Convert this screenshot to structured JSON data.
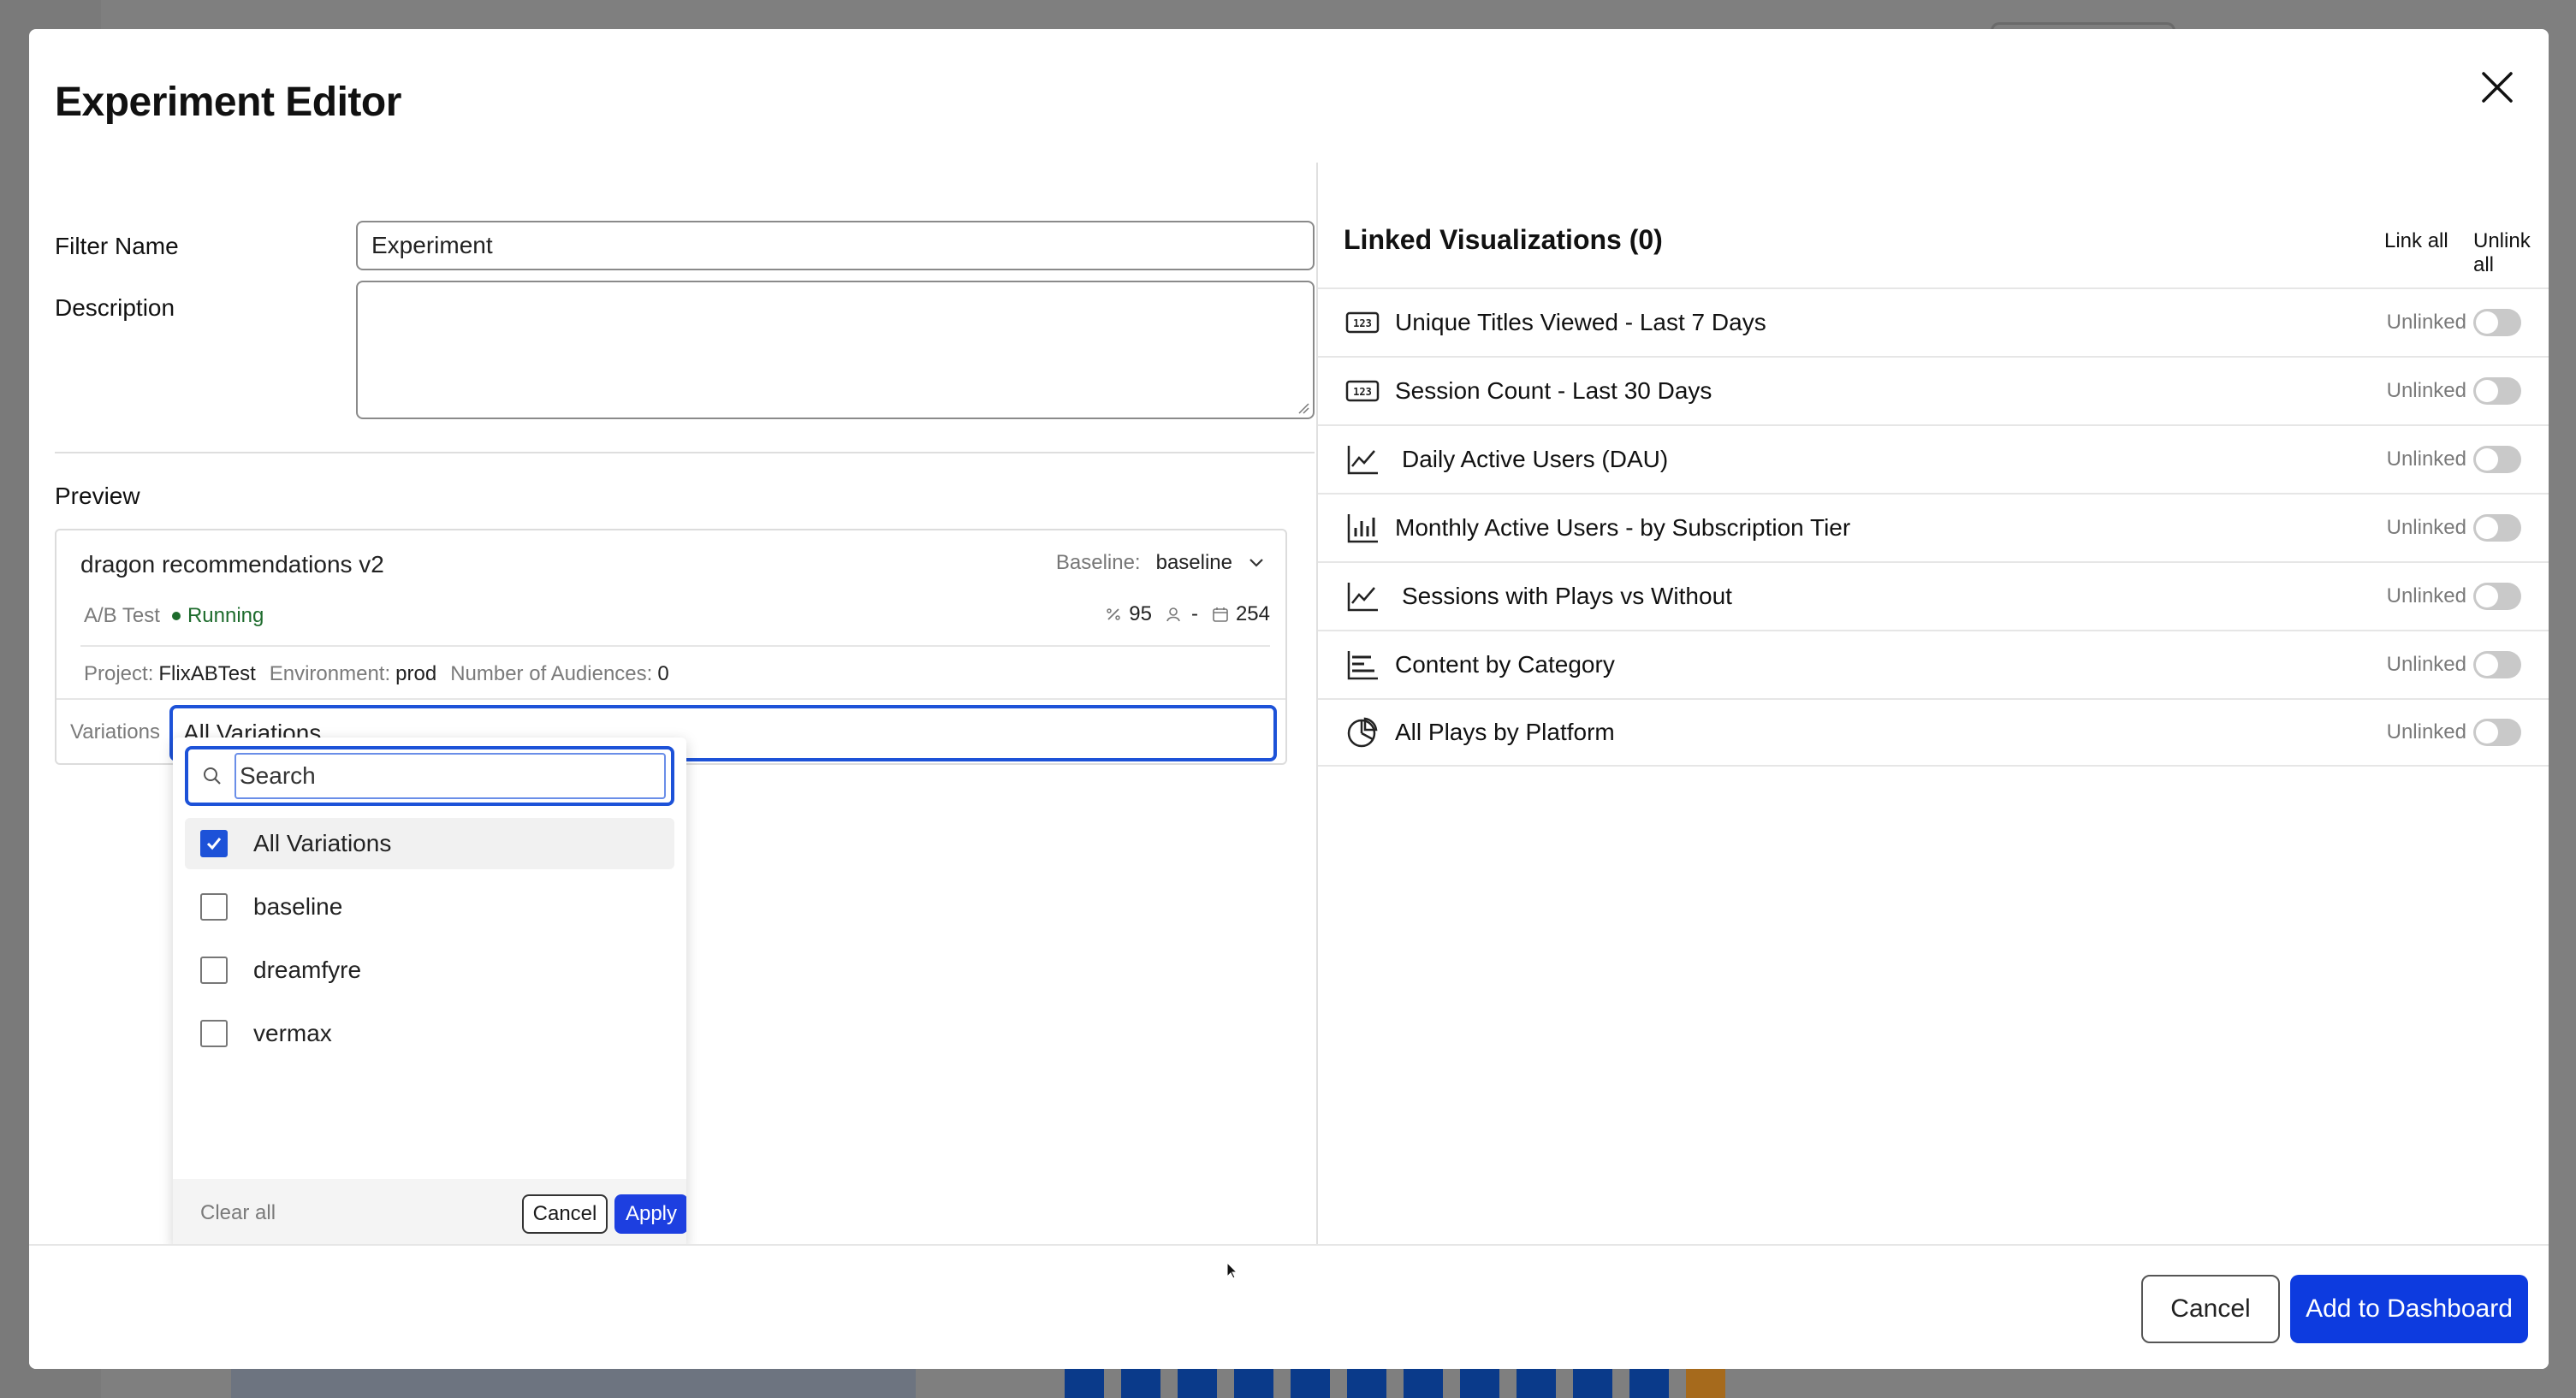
{
  "modal": {
    "title": "Experiment Editor"
  },
  "form": {
    "filter_name_label": "Filter Name",
    "filter_name_value": "Experiment",
    "description_label": "Description",
    "description_value": ""
  },
  "preview": {
    "section_title": "Preview",
    "experiment_name": "dragon recommendations v2",
    "baseline_label": "Baseline:",
    "baseline_value": "baseline",
    "type": "A/B Test",
    "status": "Running",
    "stat_traffic": "95",
    "stat_audience": "-",
    "stat_days": "254",
    "project_label": "Project:",
    "project_value": "FlixABTest",
    "environment_label": "Environment:",
    "environment_value": "prod",
    "audiences_label": "Number of Audiences:",
    "audiences_value": "0",
    "variations_label": "Variations",
    "variations_value": "All Variations"
  },
  "dropdown": {
    "search_placeholder": "Search",
    "items": [
      {
        "label": "All Variations",
        "checked": true
      },
      {
        "label": "baseline",
        "checked": false
      },
      {
        "label": "dreamfyre",
        "checked": false
      },
      {
        "label": "vermax",
        "checked": false
      }
    ],
    "clear_label": "Clear all",
    "cancel_label": "Cancel",
    "apply_label": "Apply"
  },
  "linked": {
    "title": "Linked Visualizations (0)",
    "link_all": "Link all",
    "unlink_all": "Unlink all",
    "items": [
      {
        "name": "Unique Titles Viewed - Last 7 Days",
        "icon": "number-icon",
        "status": "Unlinked"
      },
      {
        "name": "Session Count - Last 30 Days",
        "icon": "number-icon",
        "status": "Unlinked"
      },
      {
        "name": "Daily Active Users (DAU)",
        "icon": "line-chart-icon",
        "status": "Unlinked"
      },
      {
        "name": "Monthly Active Users - by Subscription Tier",
        "icon": "bar-chart-icon",
        "status": "Unlinked"
      },
      {
        "name": "Sessions with Plays vs Without",
        "icon": "line-chart-icon",
        "status": "Unlinked"
      },
      {
        "name": "Content by Category",
        "icon": "horizontal-bar-chart-icon",
        "status": "Unlinked"
      },
      {
        "name": "All Plays by Platform",
        "icon": "pie-chart-icon",
        "status": "Unlinked"
      }
    ]
  },
  "footer": {
    "cancel_label": "Cancel",
    "add_label": "Add to Dashboard"
  },
  "colors": {
    "accent": "#1d52d8",
    "primary_button": "#0d3bdf",
    "running": "#1d6b2c",
    "overlay": "#7f7f7f"
  }
}
